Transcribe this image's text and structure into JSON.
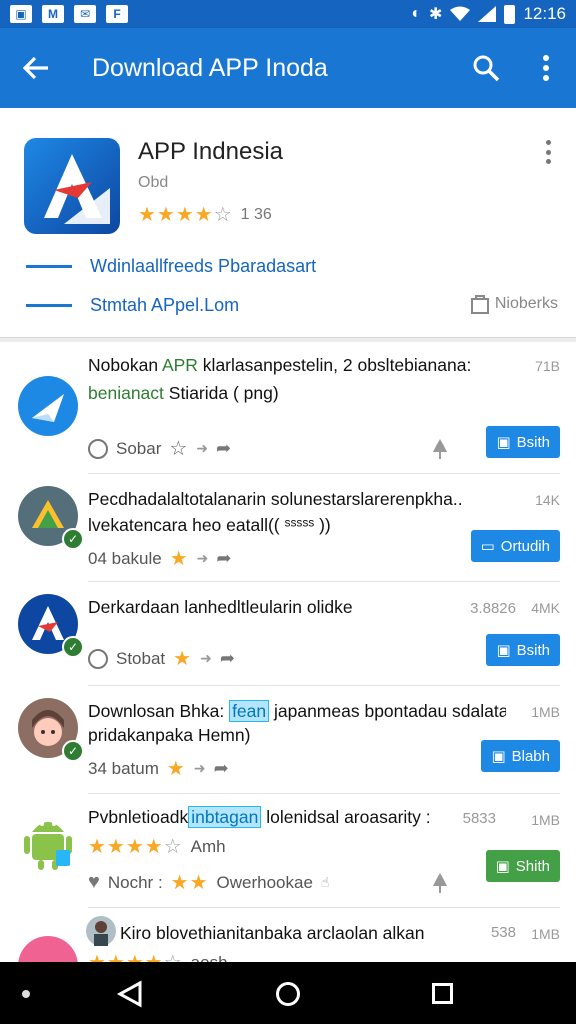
{
  "status_bar": {
    "notif_icons": [
      "image-icon",
      "gmail-icon",
      "mail-icon",
      "flipboard-icon"
    ],
    "notif_labels": [
      "▣",
      "M",
      "✉",
      "F"
    ],
    "time": "12:16"
  },
  "app_bar": {
    "title": "Download APP Inoda"
  },
  "header": {
    "app_name": "APP Indnesia",
    "developer": "Obd",
    "rating_count": "1 36",
    "link1": "Wdinlaallfreeds Pbaradasart",
    "link2": "Stmtah APpel.Lom",
    "network_label": "Nioberks"
  },
  "items": [
    {
      "title_a": "Nobokan ",
      "title_b": "APR",
      "title_c": " klarlasanpestelin, 2 obsltebianana:",
      "title2_a": "benianact",
      "title2_b": " Stiarida ( png)",
      "size": "71B",
      "meta": "Sobar",
      "button": "Bsith"
    },
    {
      "title": "Pecdhadalaltotalanarin solunestarslarerenpkha..",
      "title2": "lvekatencara heo eatall(( ˢˢˢˢˢ ))",
      "size": "14K",
      "meta": "04 bakule",
      "button": "Ortudih"
    },
    {
      "title": "Derkardaan lanhedltleularin olidke",
      "size_a": "3.8826",
      "size": "4MK",
      "meta": "Stobat",
      "button": "Bsith"
    },
    {
      "title_a": "Downlosan Bhka: ",
      "title_b": "fean",
      "title_c": " japanmeas bpontadau sdalatan",
      "title2": "pridakanpaka Hemn)",
      "size": "1MB",
      "meta": "34 batum",
      "button": "Blabh"
    },
    {
      "title_a": "Pvbnletioadk",
      "title_b": "inbtagan",
      "title_c": " lolenidsal aroasarity :",
      "size_a": "5833",
      "size": "1MB",
      "sub": "Amh",
      "meta": "Nochr :",
      "meta2": "Owerhookae",
      "button": "Shith"
    },
    {
      "title": "Kiro blovethianitanbaka arclaolan alkan",
      "size_a": "538",
      "size": "1MB",
      "sub": "aosh"
    }
  ]
}
